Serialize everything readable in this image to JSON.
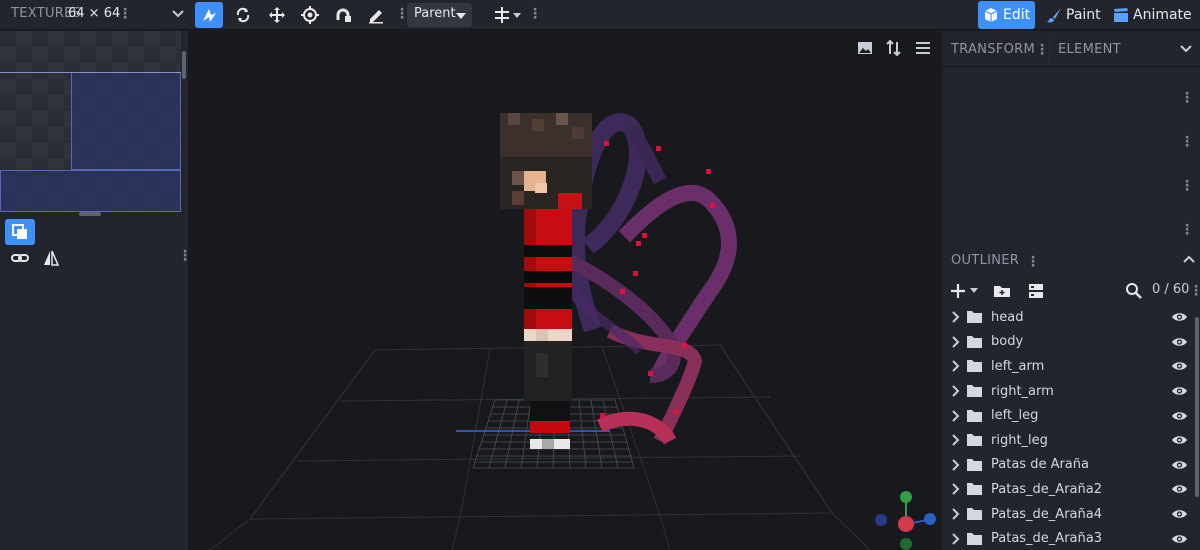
{
  "toolbar": {
    "textures_label": "TEXTURES",
    "texture_size": "64 × 64",
    "parent_select": "Parent",
    "modes": [
      {
        "label": "Edit",
        "icon": "cube-icon"
      },
      {
        "label": "Paint",
        "icon": "brush-icon"
      },
      {
        "label": "Animate",
        "icon": "clapper-icon"
      }
    ]
  },
  "right_panel": {
    "tabs": [
      "TRANSFORM",
      "ELEMENT"
    ],
    "outliner_title": "OUTLINER",
    "outliner_count": "0 / 60",
    "items": [
      "head",
      "body",
      "left_arm",
      "right_arm",
      "left_leg",
      "right_leg",
      "Patas de Araña",
      "Patas_de_Araña2",
      "Patas_de_Araña4",
      "Patas_de_Araña3"
    ]
  },
  "colors": {
    "accent": "#3e90ff",
    "panel": "#22252b",
    "viewport": "#17191d",
    "axis_x": "#d33a4b",
    "axis_y": "#2f9e44",
    "axis_z": "#2b5fc0"
  }
}
